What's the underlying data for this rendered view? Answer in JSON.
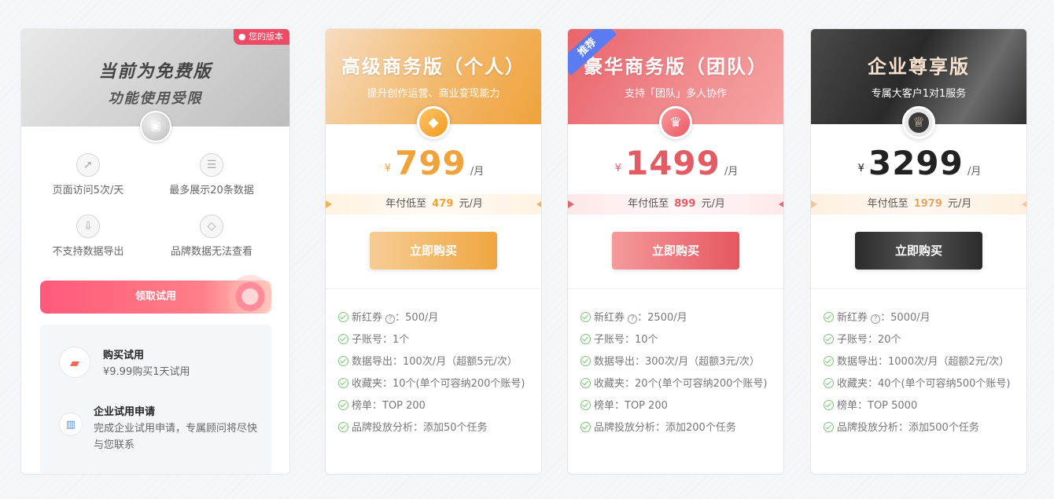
{
  "free": {
    "badge": "您的版本",
    "title": "当前为免费版",
    "subtitle": "功能使用受限",
    "features": [
      {
        "label": "页面访问5次/天",
        "icon": "arrow-icon"
      },
      {
        "label": "最多展示20条数据",
        "icon": "list-icon"
      },
      {
        "label": "不支持数据导出",
        "icon": "export-icon"
      },
      {
        "label": "品牌数据无法查看",
        "icon": "diamond-icon"
      }
    ],
    "trial_button": "领取试用",
    "trial_items": [
      {
        "title": "购买试用",
        "desc": "¥9.99购买1天试用",
        "icon": "wallet-icon"
      },
      {
        "title": "企业试用申请",
        "desc": "完成企业试用申请，专属顾问将尽快与您联系",
        "icon": "building-icon"
      }
    ]
  },
  "plans": [
    {
      "name": "高级商务版（个人）",
      "desc": "提升创作运营、商业变现能力",
      "currency": "¥",
      "price": "799",
      "unit": "/月",
      "yearly_prefix": "年付低至",
      "yearly_price": "479",
      "yearly_suffix": "元/月",
      "buy": "立即购买",
      "features": [
        "新红券",
        "：500/月",
        "子账号：1个",
        "数据导出：100次/月（超额5元/次）",
        "收藏夹：10个(单个可容纳200个账号)",
        "榜单：TOP 200",
        "品牌投放分析：添加50个任务"
      ],
      "accent": "#f0a23b"
    },
    {
      "name": "豪华商务版（团队）",
      "desc": "支持「团队」多人协作",
      "tag": "推荐",
      "currency": "¥",
      "price": "1499",
      "unit": "/月",
      "yearly_prefix": "年付低至",
      "yearly_price": "899",
      "yearly_suffix": "元/月",
      "buy": "立即购买",
      "features": [
        "新红券",
        "：2500/月",
        "子账号：10个",
        "数据导出：300次/月（超额3元/次）",
        "收藏夹：20个(单个可容纳200个账号)",
        "榜单：TOP 200",
        "品牌投放分析：添加200个任务"
      ],
      "accent": "#e35b63"
    },
    {
      "name": "企业尊享版",
      "desc": "专属大客户1对1服务",
      "currency": "¥",
      "price": "3299",
      "unit": "/月",
      "yearly_prefix": "年付低至",
      "yearly_price": "1979",
      "yearly_suffix": "元/月",
      "buy": "立即购买",
      "features": [
        "新红券",
        "：5000/月",
        "子账号：20个",
        "数据导出：1000次/月（超额2元/次）",
        "收藏夹：40个(单个可容纳500个账号)",
        "榜单：TOP 5000",
        "品牌投放分析：添加500个任务"
      ],
      "accent": "#222222"
    }
  ]
}
